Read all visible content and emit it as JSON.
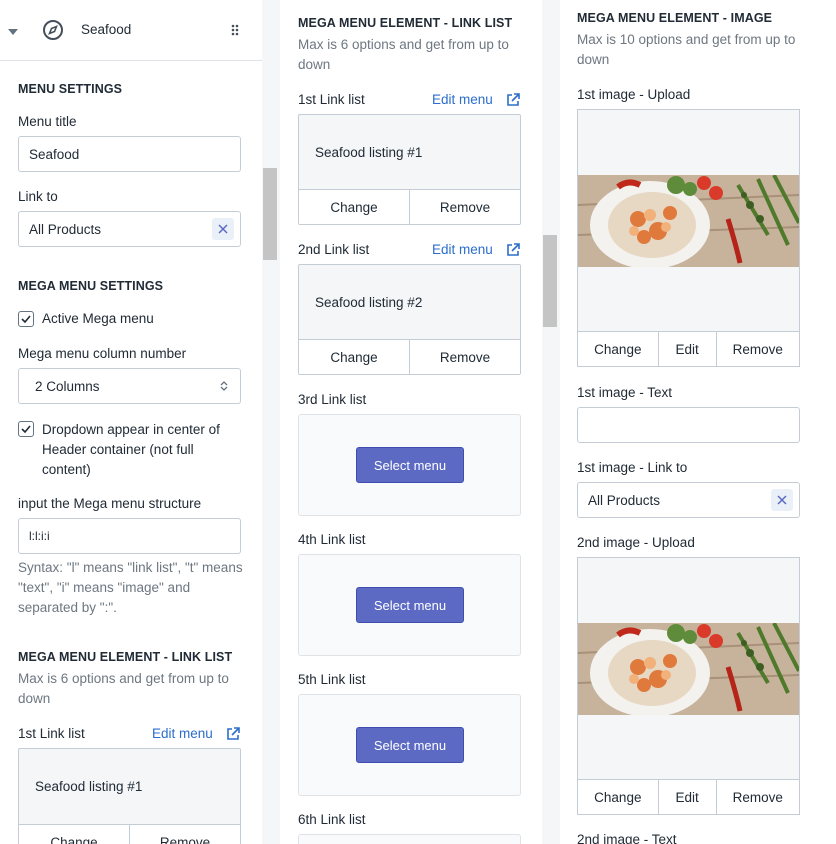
{
  "header": {
    "title": "Seafood"
  },
  "menu_settings": {
    "heading": "MENU SETTINGS",
    "title_label": "Menu title",
    "title_value": "Seafood",
    "link_label": "Link to",
    "link_value": "All Products"
  },
  "mega_settings": {
    "heading": "MEGA MENU SETTINGS",
    "active_label": "Active Mega menu",
    "column_label": "Mega menu column number",
    "column_value": "2 Columns",
    "center_label": "Dropdown appear in center of Header container (not full content)",
    "structure_label": "input the Mega menu structure",
    "structure_value": "l:l:i:i",
    "syntax_help": "Syntax: \"l\" means \"link list\", \"t\" means \"text\", \"i\" means \"image\" and separated by \":\"."
  },
  "link_list_section": {
    "heading": "MEGA MENU ELEMENT - LINK LIST",
    "help": "Max is 6 options and get from up to down",
    "edit_label": "Edit menu",
    "change_label": "Change",
    "remove_label": "Remove",
    "select_label": "Select menu",
    "items": [
      {
        "label": "1st Link list",
        "menu": "Seafood listing #1"
      },
      {
        "label": "2nd Link list",
        "menu": "Seafood listing #2"
      },
      {
        "label": "3rd Link list"
      },
      {
        "label": "4th Link list"
      },
      {
        "label": "5th Link list"
      },
      {
        "label": "6th Link list"
      }
    ]
  },
  "image_section": {
    "heading": "MEGA MENU ELEMENT - IMAGE",
    "help": "Max is 10 options and get from up to down",
    "change_label": "Change",
    "edit_label": "Edit",
    "remove_label": "Remove",
    "img1_upload": "1st image - Upload",
    "img1_text": "1st image - Text",
    "img1_text_value": "",
    "img1_link": "1st image - Link to",
    "img1_link_value": "All Products",
    "img2_upload": "2nd image - Upload",
    "img2_text": "2nd image - Text"
  },
  "colors": {
    "accent": "#5c6ac4",
    "link": "#2c6ecb",
    "border": "#c4cdd5"
  }
}
